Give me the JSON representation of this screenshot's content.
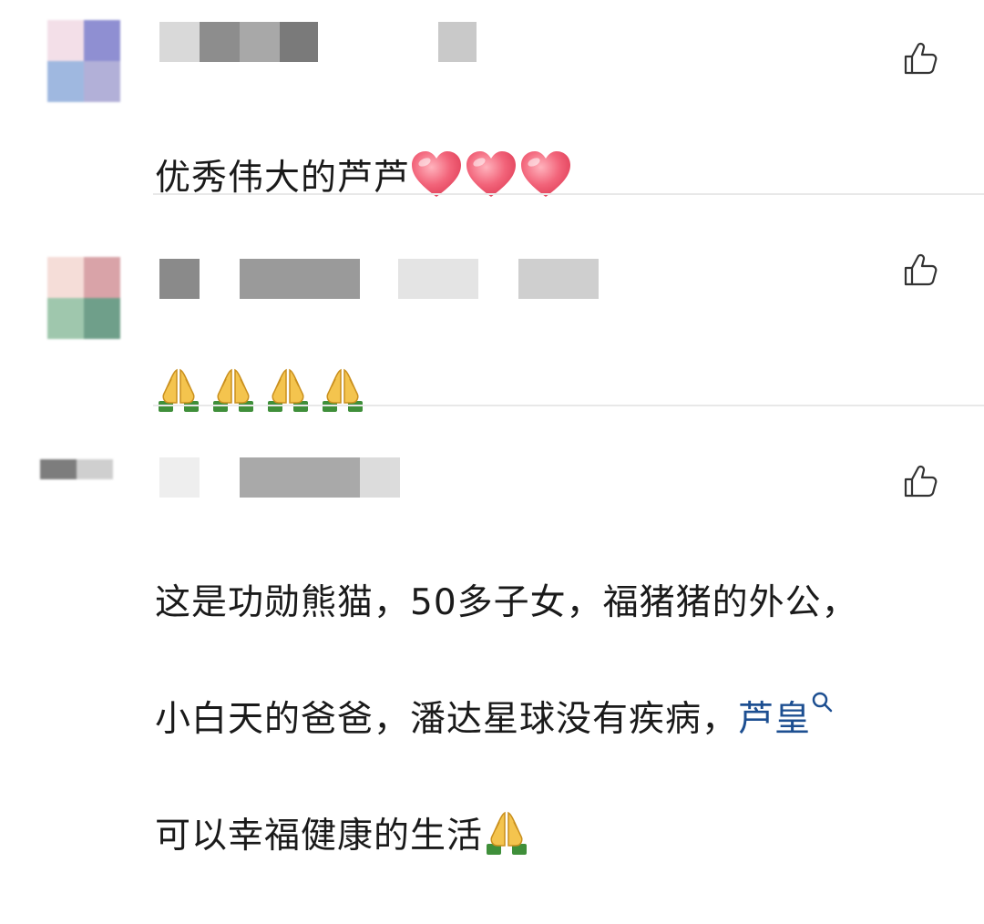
{
  "comments": [
    {
      "text": "优秀伟大的芦芦",
      "emoji": [
        "heart",
        "heart",
        "heart"
      ]
    },
    {
      "text": "",
      "emoji": [
        "pray",
        "pray",
        "pray",
        "pray"
      ]
    },
    {
      "line1": "这是功勋熊猫，50多子女，福猪猪的外公，",
      "line2": "小白天的爸爸，潘达星球没有疾病，",
      "link": "芦皇",
      "line3": "可以幸福健康的生活"
    }
  ],
  "icons": {
    "like": "thumbs-up-icon",
    "search": "search-icon",
    "heart": "heart-emoji",
    "pray": "folded-hands-emoji"
  },
  "colors": {
    "link": "#1d4f91",
    "heart": "#f0566e",
    "divider": "#e8e8e8"
  }
}
